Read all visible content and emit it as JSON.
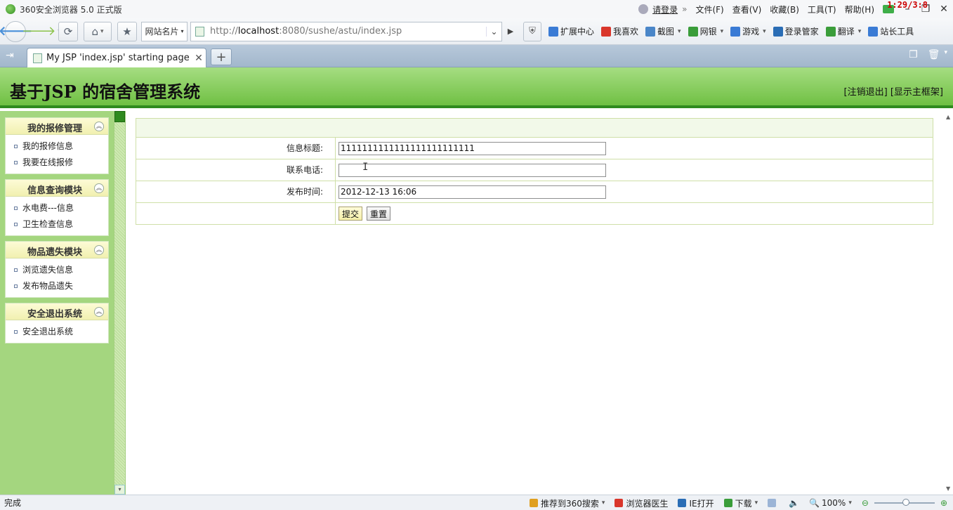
{
  "browser": {
    "title": "360安全浏览器 5.0 正式版",
    "login_link": "请登录",
    "menus": [
      "文件(F)",
      "查看(V)",
      "收藏(B)",
      "工具(T)",
      "帮助(H)"
    ],
    "clock": "1:29/3:8",
    "site_card_label": "网站名片",
    "url_prefix": "http://",
    "url_host": "localhost",
    "url_rest": ":8080/sushe/astu/index.jsp",
    "toolbar": [
      {
        "label": "扩展中心",
        "icon": "extension-icon",
        "color": "#3a7bd5",
        "dropdown": false
      },
      {
        "label": "我喜欢",
        "icon": "heart-icon",
        "color": "#d9362b",
        "dropdown": false
      },
      {
        "label": "截图",
        "icon": "screenshot-icon",
        "color": "#4a86c8",
        "dropdown": true
      },
      {
        "label": "网银",
        "icon": "bank-icon",
        "color": "#3a9d3a",
        "dropdown": true
      },
      {
        "label": "游戏",
        "icon": "game-icon",
        "color": "#3a7bd5",
        "dropdown": true
      },
      {
        "label": "登录管家",
        "icon": "key-icon",
        "color": "#2a6db5",
        "dropdown": false
      },
      {
        "label": "翻译",
        "icon": "translate-icon",
        "color": "#3a9d3a",
        "dropdown": true
      },
      {
        "label": "站长工具",
        "icon": "webmaster-icon",
        "color": "#3a7bd5",
        "dropdown": false
      }
    ],
    "tab_title": "My JSP 'index.jsp' starting page",
    "status_text": "完成",
    "status_items": [
      {
        "label": "推荐到360搜索",
        "icon": "thumb-up-icon",
        "dropdown": true
      },
      {
        "label": "浏览器医生",
        "icon": "doctor-icon",
        "dropdown": false
      },
      {
        "label": "IE打开",
        "icon": "ie-icon",
        "dropdown": false
      },
      {
        "label": "下载",
        "icon": "download-icon",
        "dropdown": true
      }
    ],
    "zoom": "100%"
  },
  "app": {
    "title": "基于JSP 的宿舍管理系统",
    "logout_link": "[注销退出]",
    "show_frame_link": "[显示主框架]"
  },
  "sidebar": {
    "groups": [
      {
        "title": "我的报修管理",
        "items": [
          "我的报修信息",
          "我要在线报修"
        ]
      },
      {
        "title": "信息查询模块",
        "items": [
          "水电费---信息",
          "卫生检查信息"
        ]
      },
      {
        "title": "物品遗失模块",
        "items": [
          "浏览遗失信息",
          "发布物品遗失"
        ]
      },
      {
        "title": "安全退出系统",
        "items": [
          "安全退出系统"
        ]
      }
    ]
  },
  "form": {
    "fields": [
      {
        "label": "信息标题:",
        "value": "1111111111111111111111111"
      },
      {
        "label": "联系电话:",
        "value": ""
      },
      {
        "label": "发布时间:",
        "value": "2012-12-13 16:06"
      }
    ],
    "submit_label": "提交",
    "reset_label": "重置"
  }
}
